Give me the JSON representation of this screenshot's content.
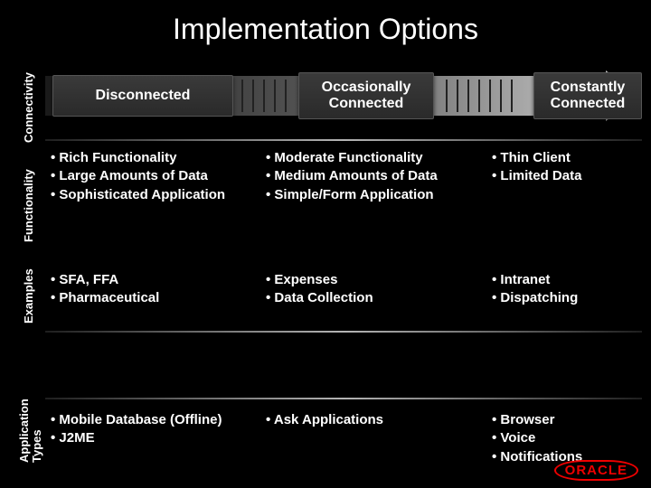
{
  "title": "Implementation Options",
  "labels": {
    "connectivity": "Connectivity",
    "functionality": "Functionality",
    "examples": "Examples",
    "apptypes": "Application\nTypes"
  },
  "connectivity": {
    "c1": "Disconnected",
    "c2": "Occasionally Connected",
    "c3": "Constantly Connected"
  },
  "functionality": {
    "c1": "• Rich Functionality\n• Large Amounts of Data\n• Sophisticated Application",
    "c2": "• Moderate Functionality\n• Medium Amounts of Data\n• Simple/Form Application",
    "c3": "• Thin Client\n• Limited Data"
  },
  "examples": {
    "c1": "• SFA, FFA\n• Pharmaceutical",
    "c2": "• Expenses\n• Data Collection",
    "c3": "• Intranet\n• Dispatching"
  },
  "apptypes": {
    "c1": "• Mobile Database (Offline)\n• J2ME",
    "c2": "• Ask Applications",
    "c3": "• Browser\n• Voice\n• Notifications"
  },
  "brand": "ORACLE"
}
